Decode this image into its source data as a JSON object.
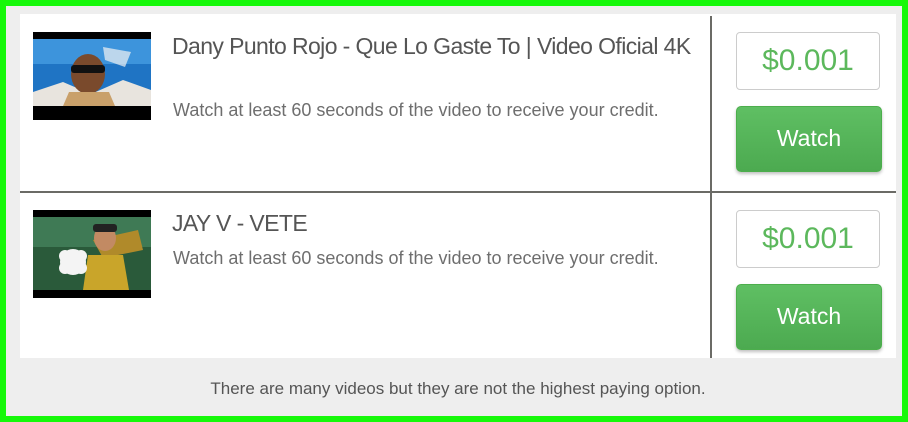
{
  "videos": [
    {
      "title": "Dany Punto Rojo - Que Lo Gaste To | Video Oficial 4K",
      "description": "Watch at least 60 seconds of the video to receive your credit.",
      "price": "$0.001",
      "button_label": "Watch"
    },
    {
      "title": "JAY V - VETE",
      "description": "Watch at least 60 seconds of the video to receive your credit.",
      "price": "$0.001",
      "button_label": "Watch"
    }
  ],
  "footer": {
    "text": "There are many videos but they are not the highest paying option."
  },
  "colors": {
    "frame_border": "#16f80a",
    "accent_green": "#5cb85c",
    "text": "#555555"
  }
}
